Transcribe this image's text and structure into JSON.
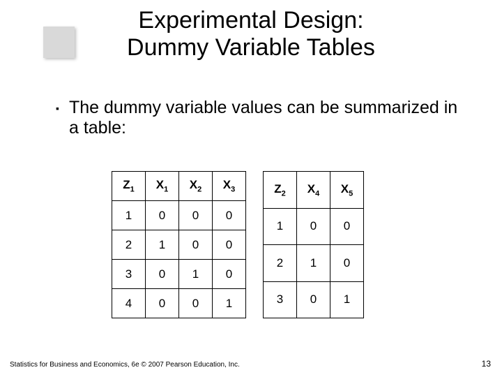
{
  "title_line1": "Experimental Design:",
  "title_line2": "Dummy Variable Tables",
  "bullet_text": "The dummy variable values can be summarized in a table:",
  "table1": {
    "headers": [
      {
        "base": "Z",
        "sub": "1"
      },
      {
        "base": "X",
        "sub": "1"
      },
      {
        "base": "X",
        "sub": "2"
      },
      {
        "base": "X",
        "sub": "3"
      }
    ],
    "rows": [
      [
        "1",
        "0",
        "0",
        "0"
      ],
      [
        "2",
        "1",
        "0",
        "0"
      ],
      [
        "3",
        "0",
        "1",
        "0"
      ],
      [
        "4",
        "0",
        "0",
        "1"
      ]
    ]
  },
  "table2": {
    "headers": [
      {
        "base": "Z",
        "sub": "2"
      },
      {
        "base": "X",
        "sub": "4"
      },
      {
        "base": "X",
        "sub": "5"
      }
    ],
    "rows": [
      [
        "1",
        "0",
        "0"
      ],
      [
        "2",
        "1",
        "0"
      ],
      [
        "3",
        "0",
        "1"
      ]
    ]
  },
  "footer": "Statistics for Business and Economics, 6e © 2007 Pearson Education, Inc.",
  "page_number": "13"
}
